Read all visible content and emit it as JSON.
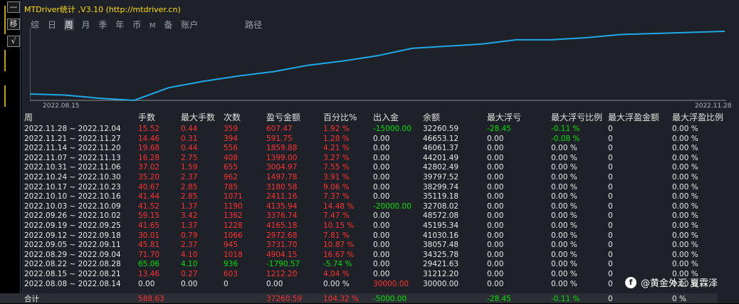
{
  "window": {
    "title": "MTDriver统计 ,V3.10 (http://mtdriver.cn)",
    "strip_buttons": [
      "—",
      "移",
      "√"
    ]
  },
  "tabs": [
    {
      "label": "综",
      "active": false
    },
    {
      "label": "日",
      "active": false
    },
    {
      "label": "周",
      "active": true
    },
    {
      "label": "月",
      "active": false
    },
    {
      "label": "季",
      "active": false
    },
    {
      "label": "年",
      "active": false
    },
    {
      "label": "币",
      "active": false
    },
    {
      "label": "M",
      "active": false,
      "small": true
    },
    {
      "label": "备",
      "active": false
    },
    {
      "label": "账户",
      "active": false
    },
    {
      "label": "路径",
      "active": false
    }
  ],
  "chart_data": {
    "type": "line",
    "x_start_label": "2022.08.15",
    "x_end_label": "2022.11.28",
    "color": "#1fa8e8",
    "values": [
      3,
      2.5,
      1,
      0,
      6,
      9,
      11.5,
      13.5,
      16.5,
      18.5,
      21,
      24.5,
      25.5,
      26.5,
      28.5,
      28.5,
      29.5,
      31,
      31.5,
      32,
      32.5
    ]
  },
  "table": {
    "headers": [
      "周",
      "手数",
      "最大手数",
      "次数",
      "盈亏金额",
      "百分比%",
      "出入金",
      "余额",
      "最大浮亏",
      "最大浮亏比例",
      "最大浮盈金额",
      "最大浮盈比例"
    ],
    "rows": [
      {
        "week": "2022.11.28 ~ 2022.12.04",
        "lots": "15.52",
        "max_lots": "0.44",
        "count": "359",
        "pnl": "607.47",
        "pct": "1.92 %",
        "flow": "-15000.00",
        "balance": "32260.59",
        "max_dd": "-28.45",
        "max_dd_pct": "-0.11 %",
        "max_fp": "0",
        "max_fp_pct": "0.00 %",
        "color": "red",
        "flow_color": "grn",
        "dd_color": "grn"
      },
      {
        "week": "2022.11.21 ~ 2022.11.27",
        "lots": "14.46",
        "max_lots": "0.31",
        "count": "394",
        "pnl": "591.75",
        "pct": "1.28 %",
        "flow": "0.00",
        "balance": "46653.12",
        "max_dd": "0.00",
        "max_dd_pct": "-0.08 %",
        "max_fp": "0",
        "max_fp_pct": "0.00 %",
        "color": "red",
        "flow_color": "wht",
        "dd_color": "wht",
        "ddp_color": "grn"
      },
      {
        "week": "2022.11.14 ~ 2022.11.20",
        "lots": "19.68",
        "max_lots": "0.44",
        "count": "556",
        "pnl": "1859.88",
        "pct": "4.21 %",
        "flow": "0.00",
        "balance": "46061.37",
        "max_dd": "0.00",
        "max_dd_pct": "0.00 %",
        "max_fp": "0",
        "max_fp_pct": "0.00 %",
        "color": "red"
      },
      {
        "week": "2022.11.07 ~ 2022.11.13",
        "lots": "16.28",
        "max_lots": "2.75",
        "count": "408",
        "pnl": "1399.00",
        "pct": "3.27 %",
        "flow": "0.00",
        "balance": "44201.49",
        "max_dd": "0.00",
        "max_dd_pct": "0.00 %",
        "max_fp": "0",
        "max_fp_pct": "0.00 %",
        "color": "red"
      },
      {
        "week": "2022.10.31 ~ 2022.11.06",
        "lots": "37.02",
        "max_lots": "1.59",
        "count": "655",
        "pnl": "3004.97",
        "pct": "7.55 %",
        "flow": "0.00",
        "balance": "42802.49",
        "max_dd": "0.00",
        "max_dd_pct": "0.00 %",
        "max_fp": "0",
        "max_fp_pct": "0.00 %",
        "color": "red"
      },
      {
        "week": "2022.10.24 ~ 2022.10.30",
        "lots": "35.20",
        "max_lots": "2.37",
        "count": "962",
        "pnl": "1497.78",
        "pct": "3.91 %",
        "flow": "0.00",
        "balance": "39797.52",
        "max_dd": "0.00",
        "max_dd_pct": "0.00 %",
        "max_fp": "0",
        "max_fp_pct": "0.00 %",
        "color": "red"
      },
      {
        "week": "2022.10.17 ~ 2022.10.23",
        "lots": "40.67",
        "max_lots": "2.85",
        "count": "785",
        "pnl": "3180.58",
        "pct": "9.06 %",
        "flow": "0.00",
        "balance": "38299.74",
        "max_dd": "0.00",
        "max_dd_pct": "0.00 %",
        "max_fp": "0",
        "max_fp_pct": "0.00 %",
        "color": "red"
      },
      {
        "week": "2022.10.10 ~ 2022.10.16",
        "lots": "41.44",
        "max_lots": "2.85",
        "count": "1071",
        "pnl": "2411.16",
        "pct": "7.37 %",
        "flow": "0.00",
        "balance": "35119.18",
        "max_dd": "0.00",
        "max_dd_pct": "0.00 %",
        "max_fp": "0",
        "max_fp_pct": "0.00 %",
        "color": "red"
      },
      {
        "week": "2022.10.03 ~ 2022.10.09",
        "lots": "41.52",
        "max_lots": "1.37",
        "count": "1190",
        "pnl": "4135.94",
        "pct": "14.48 %",
        "flow": "-20000.00",
        "balance": "32708.02",
        "max_dd": "0.00",
        "max_dd_pct": "0.00 %",
        "max_fp": "0",
        "max_fp_pct": "0.00 %",
        "color": "red",
        "flow_color": "grn"
      },
      {
        "week": "2022.09.26 ~ 2022.10.02",
        "lots": "59.15",
        "max_lots": "3.42",
        "count": "1362",
        "pnl": "3376.74",
        "pct": "7.47 %",
        "flow": "0.00",
        "balance": "48572.08",
        "max_dd": "0.00",
        "max_dd_pct": "0.00 %",
        "max_fp": "0",
        "max_fp_pct": "0.00 %",
        "color": "red"
      },
      {
        "week": "2022.09.19 ~ 2022.09.25",
        "lots": "41.65",
        "max_lots": "1.37",
        "count": "1228",
        "pnl": "4165.18",
        "pct": "10.15 %",
        "flow": "0.00",
        "balance": "45195.34",
        "max_dd": "0.00",
        "max_dd_pct": "0.00 %",
        "max_fp": "0",
        "max_fp_pct": "0.00 %",
        "color": "red"
      },
      {
        "week": "2022.09.12 ~ 2022.09.18",
        "lots": "30.01",
        "max_lots": "0.79",
        "count": "1066",
        "pnl": "2972.68",
        "pct": "7.81 %",
        "flow": "0.00",
        "balance": "41030.16",
        "max_dd": "0.00",
        "max_dd_pct": "0.00 %",
        "max_fp": "0",
        "max_fp_pct": "0.00 %",
        "color": "red"
      },
      {
        "week": "2022.09.05 ~ 2022.09.11",
        "lots": "45.81",
        "max_lots": "2.37",
        "count": "945",
        "pnl": "3731.70",
        "pct": "10.87 %",
        "flow": "0.00",
        "balance": "38057.48",
        "max_dd": "0.00",
        "max_dd_pct": "0.00 %",
        "max_fp": "0",
        "max_fp_pct": "0.00 %",
        "color": "red"
      },
      {
        "week": "2022.08.29 ~ 2022.09.04",
        "lots": "71.70",
        "max_lots": "4.10",
        "count": "1018",
        "pnl": "4904.15",
        "pct": "16.67 %",
        "flow": "0.00",
        "balance": "34325.78",
        "max_dd": "0.00",
        "max_dd_pct": "0.00 %",
        "max_fp": "0",
        "max_fp_pct": "0.00 %",
        "color": "red"
      },
      {
        "week": "2022.08.22 ~ 2022.08.28",
        "lots": "65.06",
        "max_lots": "4.10",
        "count": "936",
        "pnl": "-1790.57",
        "pct": "-5.74 %",
        "flow": "0.00",
        "balance": "29421.63",
        "max_dd": "0.00",
        "max_dd_pct": "0.00 %",
        "max_fp": "0",
        "max_fp_pct": "0.00 %",
        "color": "grn"
      },
      {
        "week": "2022.08.15 ~ 2022.08.21",
        "lots": "13.46",
        "max_lots": "0.27",
        "count": "603",
        "pnl": "1212.20",
        "pct": "4.04 %",
        "flow": "0.00",
        "balance": "31212.20",
        "max_dd": "0.00",
        "max_dd_pct": "0.00 %",
        "max_fp": "0",
        "max_fp_pct": "0.00 %",
        "color": "red"
      },
      {
        "week": "2022.08.08 ~ 2022.08.14",
        "lots": "0.00",
        "max_lots": "0.00",
        "count": "0",
        "pnl": "0.00",
        "pct": "0.00 %",
        "flow": "30000.00",
        "balance": "30000.00",
        "max_dd": "0.00",
        "max_dd_pct": "0.00 %",
        "max_fp": "0",
        "max_fp_pct": "0.00 %",
        "color": "wht",
        "flow_color": "red"
      }
    ],
    "total": {
      "label": "合计",
      "lots": "588.63",
      "pnl": "37260.59",
      "pct": "104.32 %",
      "flow": "-5000.00",
      "max_dd": "-28.45",
      "max_dd_pct": "-0.11 %",
      "max_fp": "0",
      "max_fp_pct": "0 %"
    }
  },
  "watermark": {
    "icon": "f",
    "text": "@黄金外汇 夏霖泽"
  }
}
